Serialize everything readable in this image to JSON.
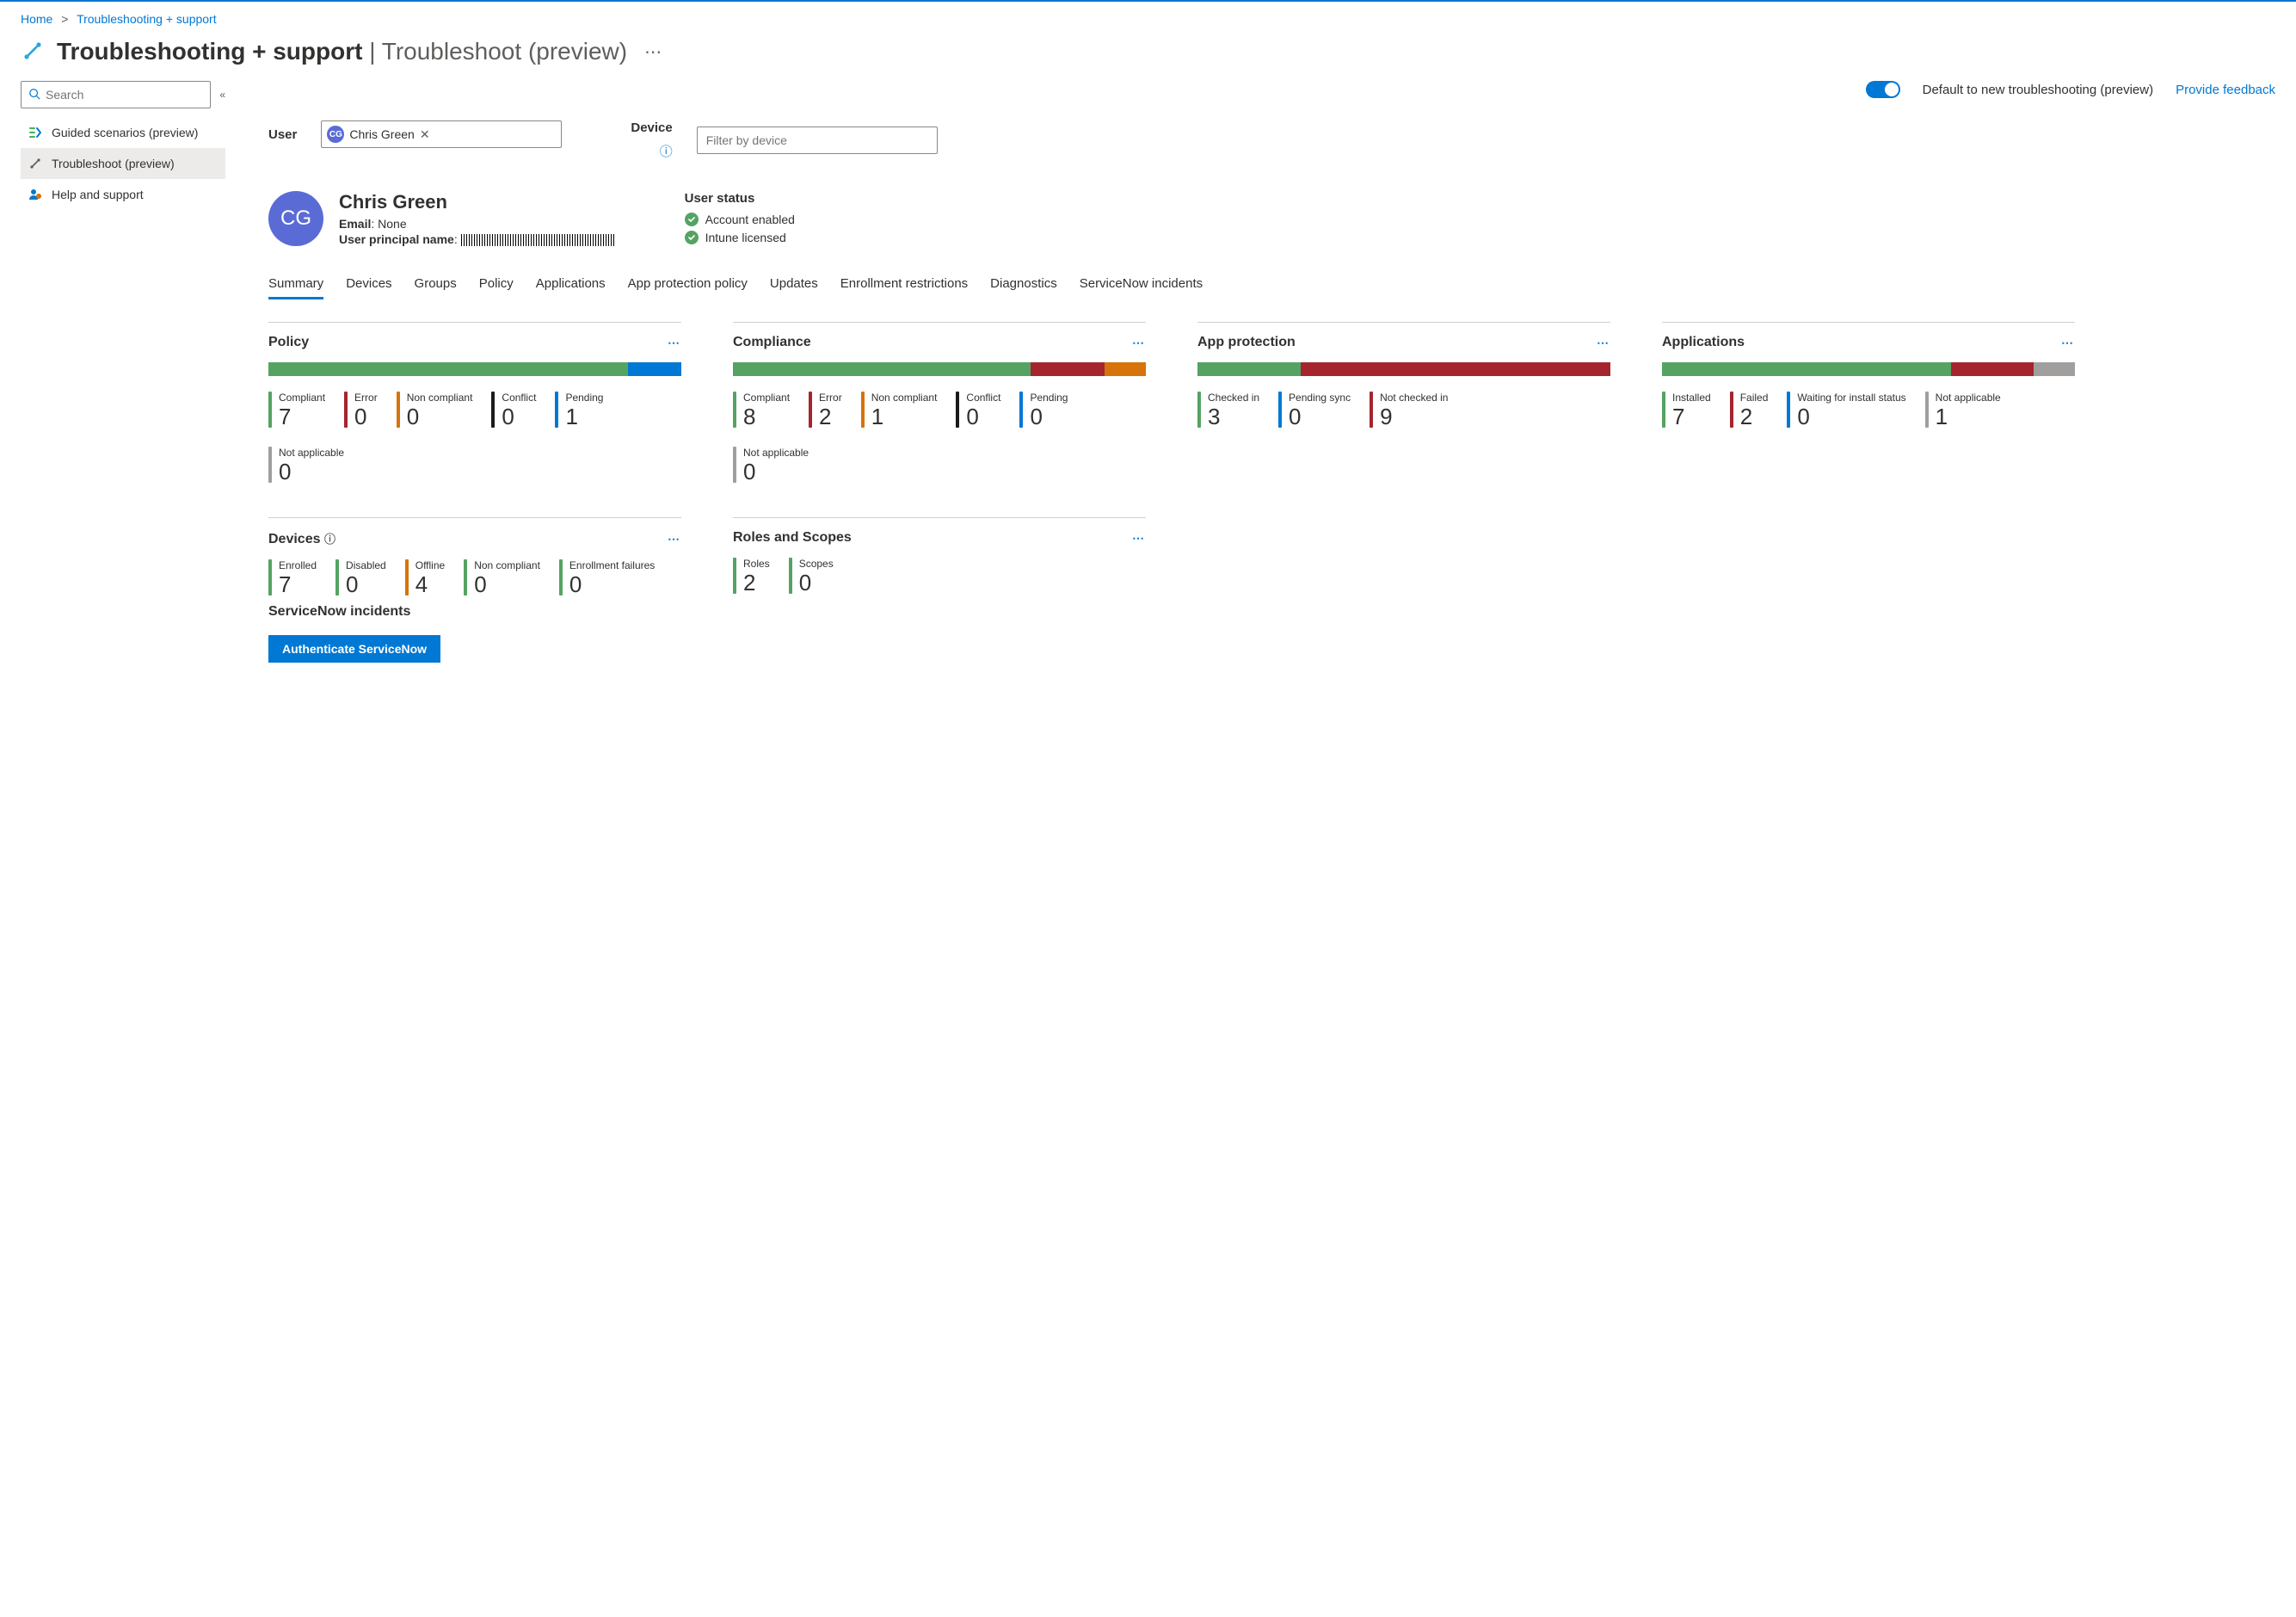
{
  "breadcrumb": {
    "home": "Home",
    "current": "Troubleshooting + support"
  },
  "title": {
    "main": "Troubleshooting + support",
    "sub": "Troubleshoot (preview)"
  },
  "sidebar": {
    "search_placeholder": "Search",
    "items": [
      {
        "label": "Guided scenarios (preview)"
      },
      {
        "label": "Troubleshoot (preview)"
      },
      {
        "label": "Help and support"
      }
    ]
  },
  "toolbar": {
    "toggle_label": "Default to new troubleshooting (preview)",
    "feedback": "Provide feedback"
  },
  "filters": {
    "user_label": "User",
    "user_chip": "Chris Green",
    "user_initials": "CG",
    "device_label": "Device",
    "device_placeholder": "Filter by device"
  },
  "user": {
    "initials": "CG",
    "name": "Chris Green",
    "email_label": "Email",
    "email_value": "None",
    "upn_label": "User principal name"
  },
  "status": {
    "title": "User status",
    "items": [
      {
        "label": "Account enabled"
      },
      {
        "label": "Intune licensed"
      }
    ]
  },
  "tabs": [
    {
      "label": "Summary",
      "active": true
    },
    {
      "label": "Devices"
    },
    {
      "label": "Groups"
    },
    {
      "label": "Policy"
    },
    {
      "label": "Applications"
    },
    {
      "label": "App protection policy"
    },
    {
      "label": "Updates"
    },
    {
      "label": "Enrollment restrictions"
    },
    {
      "label": "Diagnostics"
    },
    {
      "label": "ServiceNow incidents"
    }
  ],
  "cards": {
    "policy": {
      "title": "Policy",
      "bar": [
        {
          "c": "c-green",
          "w": 87
        },
        {
          "c": "c-blue",
          "w": 13
        }
      ],
      "items": [
        {
          "label": "Compliant",
          "value": "7",
          "c": "c-green"
        },
        {
          "label": "Error",
          "value": "0",
          "c": "c-red"
        },
        {
          "label": "Non compliant",
          "value": "0",
          "c": "c-orange"
        },
        {
          "label": "Conflict",
          "value": "0",
          "c": "c-black"
        },
        {
          "label": "Pending",
          "value": "1",
          "c": "c-blue"
        },
        {
          "label": "Not applicable",
          "value": "0",
          "c": "c-gray"
        }
      ]
    },
    "compliance": {
      "title": "Compliance",
      "bar": [
        {
          "c": "c-green",
          "w": 72
        },
        {
          "c": "c-red",
          "w": 18
        },
        {
          "c": "c-orange",
          "w": 10
        }
      ],
      "items": [
        {
          "label": "Compliant",
          "value": "8",
          "c": "c-green"
        },
        {
          "label": "Error",
          "value": "2",
          "c": "c-red"
        },
        {
          "label": "Non compliant",
          "value": "1",
          "c": "c-orange"
        },
        {
          "label": "Conflict",
          "value": "0",
          "c": "c-black"
        },
        {
          "label": "Pending",
          "value": "0",
          "c": "c-blue"
        },
        {
          "label": "Not applicable",
          "value": "0",
          "c": "c-gray"
        }
      ]
    },
    "approt": {
      "title": "App protection",
      "bar": [
        {
          "c": "c-green",
          "w": 25
        },
        {
          "c": "c-red",
          "w": 75
        }
      ],
      "items": [
        {
          "label": "Checked in",
          "value": "3",
          "c": "c-green"
        },
        {
          "label": "Pending sync",
          "value": "0",
          "c": "c-blue"
        },
        {
          "label": "Not checked in",
          "value": "9",
          "c": "c-red"
        }
      ]
    },
    "apps": {
      "title": "Applications",
      "bar": [
        {
          "c": "c-green",
          "w": 70
        },
        {
          "c": "c-red",
          "w": 20
        },
        {
          "c": "c-gray",
          "w": 10
        }
      ],
      "items": [
        {
          "label": "Installed",
          "value": "7",
          "c": "c-green"
        },
        {
          "label": "Failed",
          "value": "2",
          "c": "c-red"
        },
        {
          "label": "Waiting for install status",
          "value": "0",
          "c": "c-blue"
        },
        {
          "label": "Not applicable",
          "value": "1",
          "c": "c-gray"
        }
      ]
    },
    "devices": {
      "title": "Devices",
      "items": [
        {
          "label": "Enrolled",
          "value": "7",
          "c": "c-green"
        },
        {
          "label": "Disabled",
          "value": "0",
          "c": "c-green"
        },
        {
          "label": "Offline",
          "value": "4",
          "c": "c-orange"
        },
        {
          "label": "Non compliant",
          "value": "0",
          "c": "c-green"
        },
        {
          "label": "Enrollment failures",
          "value": "0",
          "c": "c-green"
        }
      ]
    },
    "roles": {
      "title": "Roles and Scopes",
      "items": [
        {
          "label": "Roles",
          "value": "2",
          "c": "c-green"
        },
        {
          "label": "Scopes",
          "value": "0",
          "c": "c-green"
        }
      ]
    }
  },
  "servicenow": {
    "title": "ServiceNow incidents",
    "button": "Authenticate ServiceNow"
  }
}
